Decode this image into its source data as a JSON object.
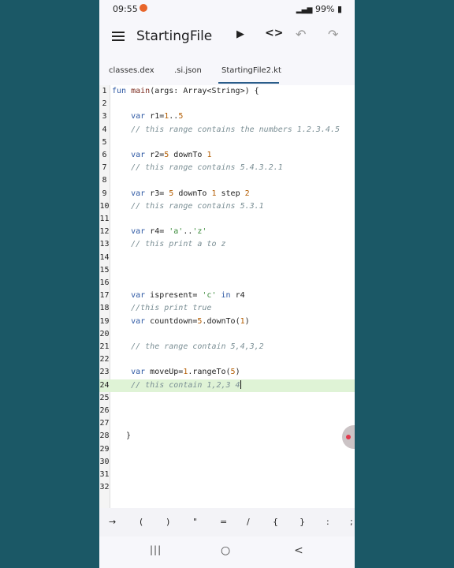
{
  "status": {
    "time": "09:55",
    "battery": "99%",
    "signal": "▂▄▆"
  },
  "toolbar": {
    "title": "StartingFile",
    "run_icon": "▶",
    "code_icon": "<>",
    "undo_icon": "↶",
    "redo_icon": "↷"
  },
  "tabs": [
    "classes.dex",
    ".si.json",
    "StartingFile2.kt"
  ],
  "editor": {
    "lines": [
      {
        "n": "1",
        "html": "<span class=\"kw\">fun</span> <span class=\"fn\">main</span>(args: Array&lt;String&gt;) {"
      },
      {
        "n": "2",
        "html": ""
      },
      {
        "n": "3",
        "html": "    <span class=\"kw\">var</span> r1=<span class=\"num\">1</span>..<span class=\"num\">5</span>"
      },
      {
        "n": "4",
        "html": "    <span class=\"cm\">// this range contains the numbers 1.2.3.4.5</span>"
      },
      {
        "n": "5",
        "html": ""
      },
      {
        "n": "6",
        "html": "    <span class=\"kw\">var</span> r2=<span class=\"num\">5</span> downTo <span class=\"num\">1</span>"
      },
      {
        "n": "7",
        "html": "    <span class=\"cm\">// this range contains 5.4.3.2.1</span>"
      },
      {
        "n": "8",
        "html": ""
      },
      {
        "n": "9",
        "html": "    <span class=\"kw\">var</span> r3= <span class=\"num\">5</span> downTo <span class=\"num\">1</span> step <span class=\"num\">2</span>"
      },
      {
        "n": "10",
        "html": "    <span class=\"cm\">// this range contains 5.3.1</span>"
      },
      {
        "n": "11",
        "html": ""
      },
      {
        "n": "12",
        "html": "    <span class=\"kw\">var</span> r4= <span class=\"str\">'a'</span>..<span class=\"str\">'z'</span>"
      },
      {
        "n": "13",
        "html": "    <span class=\"cm\">// this print a to z</span>"
      },
      {
        "n": "14",
        "html": ""
      },
      {
        "n": "15",
        "html": ""
      },
      {
        "n": "16",
        "html": ""
      },
      {
        "n": "17",
        "html": "    <span class=\"kw\">var</span> ispresent= <span class=\"str\">'c'</span> <span class=\"kw\">in</span> r4"
      },
      {
        "n": "18",
        "html": "    <span class=\"cm\">//this print true</span>"
      },
      {
        "n": "19",
        "html": "    <span class=\"kw\">var</span> countdown=<span class=\"num\">5</span>.downTo(<span class=\"num\">1</span>)"
      },
      {
        "n": "20",
        "html": ""
      },
      {
        "n": "21",
        "html": "    <span class=\"cm\">// the range contain 5,4,3,2</span>"
      },
      {
        "n": "22",
        "html": ""
      },
      {
        "n": "23",
        "html": "    <span class=\"kw\">var</span> moveUp=<span class=\"num\">1</span>.rangeTo(<span class=\"num\">5</span>)"
      },
      {
        "n": "24",
        "html": "    <span class=\"cm\">// this contain 1,2,3 4</span><span class=\"caret\"></span>",
        "highlight": true
      },
      {
        "n": "25",
        "html": ""
      },
      {
        "n": "26",
        "html": ""
      },
      {
        "n": "27",
        "html": ""
      },
      {
        "n": "28",
        "html": "   }"
      },
      {
        "n": "29",
        "html": ""
      },
      {
        "n": "30",
        "html": ""
      },
      {
        "n": "31",
        "html": ""
      },
      {
        "n": "32",
        "html": ""
      }
    ]
  },
  "symbols": [
    "→",
    "(",
    ")",
    "\"",
    "=",
    "/",
    "{",
    "}",
    ":",
    ";"
  ],
  "navbar": {
    "recents": "|||",
    "home": "○",
    "back": "<"
  }
}
